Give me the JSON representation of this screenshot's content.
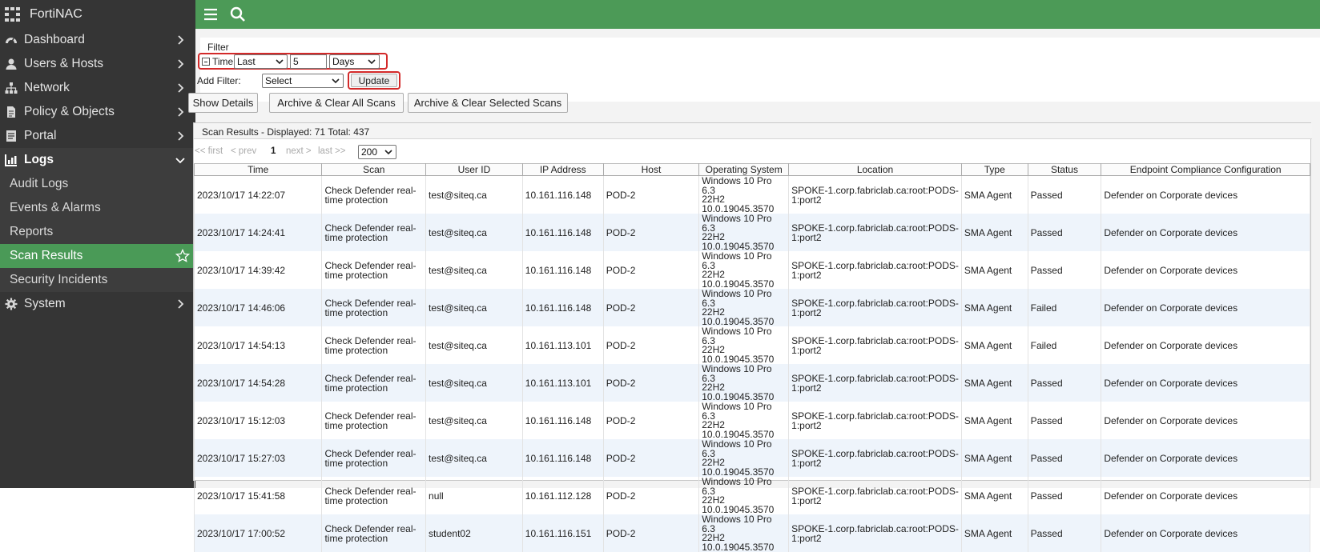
{
  "app": {
    "title": "FortiNAC"
  },
  "sidebar": {
    "items": [
      {
        "label": "Dashboard",
        "icon": "dashboard-icon"
      },
      {
        "label": "Users & Hosts",
        "icon": "user-icon"
      },
      {
        "label": "Network",
        "icon": "network-icon"
      },
      {
        "label": "Policy & Objects",
        "icon": "policy-icon"
      },
      {
        "label": "Portal",
        "icon": "portal-icon"
      },
      {
        "label": "Logs",
        "icon": "logs-icon"
      },
      {
        "label": "System",
        "icon": "gear-icon"
      }
    ],
    "logs_sub": [
      "Audit Logs",
      "Events & Alarms",
      "Reports",
      "Scan Results",
      "Security Incidents"
    ]
  },
  "filter": {
    "title": "Filter",
    "time_label": "Time:",
    "time_mode": "Last",
    "time_value": "5",
    "time_unit": "Days",
    "add_filter_label": "Add Filter:",
    "add_filter_value": "Select",
    "update_label": "Update"
  },
  "actions": {
    "show_details": "Show Details",
    "archive_all": "Archive & Clear All Scans",
    "archive_selected": "Archive & Clear Selected Scans"
  },
  "results": {
    "title": "Scan Results - Displayed: 71 Total: 437",
    "pagination": {
      "first": "<< first",
      "prev": "< prev",
      "current": "1",
      "next": "next >",
      "last": "last >>",
      "page_size": "200"
    },
    "columns": [
      "Time",
      "Scan",
      "User ID",
      "IP Address",
      "Host",
      "Operating System",
      "Location",
      "Type",
      "Status",
      "Endpoint Compliance Configuration"
    ],
    "rows": [
      {
        "time": "2023/10/17 14:22:07",
        "scan": "Check Defender real-time protection",
        "user": "test@siteq.ca",
        "ip": "10.161.116.148",
        "host": "POD-2",
        "os1": "Windows 10 Pro 6.3",
        "os2": "22H2",
        "os3": "10.0.19045.3570",
        "loc": "SPOKE-1.corp.fabriclab.ca:root:PODS-1:port2",
        "type": "SMA Agent",
        "status": "Passed",
        "config": "Defender on Corporate devices"
      },
      {
        "time": "2023/10/17 14:24:41",
        "scan": "Check Defender real-time protection",
        "user": "test@siteq.ca",
        "ip": "10.161.116.148",
        "host": "POD-2",
        "os1": "Windows 10 Pro 6.3",
        "os2": "22H2",
        "os3": "10.0.19045.3570",
        "loc": "SPOKE-1.corp.fabriclab.ca:root:PODS-1:port2",
        "type": "SMA Agent",
        "status": "Passed",
        "config": "Defender on Corporate devices"
      },
      {
        "time": "2023/10/17 14:39:42",
        "scan": "Check Defender real-time protection",
        "user": "test@siteq.ca",
        "ip": "10.161.116.148",
        "host": "POD-2",
        "os1": "Windows 10 Pro 6.3",
        "os2": "22H2",
        "os3": "10.0.19045.3570",
        "loc": "SPOKE-1.corp.fabriclab.ca:root:PODS-1:port2",
        "type": "SMA Agent",
        "status": "Passed",
        "config": "Defender on Corporate devices"
      },
      {
        "time": "2023/10/17 14:46:06",
        "scan": "Check Defender real-time protection",
        "user": "test@siteq.ca",
        "ip": "10.161.116.148",
        "host": "POD-2",
        "os1": "Windows 10 Pro 6.3",
        "os2": "22H2",
        "os3": "10.0.19045.3570",
        "loc": "SPOKE-1.corp.fabriclab.ca:root:PODS-1:port2",
        "type": "SMA Agent",
        "status": "Failed",
        "config": "Defender on Corporate devices"
      },
      {
        "time": "2023/10/17 14:54:13",
        "scan": "Check Defender real-time protection",
        "user": "test@siteq.ca",
        "ip": "10.161.113.101",
        "host": "POD-2",
        "os1": "Windows 10 Pro 6.3",
        "os2": "22H2",
        "os3": "10.0.19045.3570",
        "loc": "SPOKE-1.corp.fabriclab.ca:root:PODS-1:port2",
        "type": "SMA Agent",
        "status": "Failed",
        "config": "Defender on Corporate devices"
      },
      {
        "time": "2023/10/17 14:54:28",
        "scan": "Check Defender real-time protection",
        "user": "test@siteq.ca",
        "ip": "10.161.113.101",
        "host": "POD-2",
        "os1": "Windows 10 Pro 6.3",
        "os2": "22H2",
        "os3": "10.0.19045.3570",
        "loc": "SPOKE-1.corp.fabriclab.ca:root:PODS-1:port2",
        "type": "SMA Agent",
        "status": "Passed",
        "config": "Defender on Corporate devices"
      },
      {
        "time": "2023/10/17 15:12:03",
        "scan": "Check Defender real-time protection",
        "user": "test@siteq.ca",
        "ip": "10.161.116.148",
        "host": "POD-2",
        "os1": "Windows 10 Pro 6.3",
        "os2": "22H2",
        "os3": "10.0.19045.3570",
        "loc": "SPOKE-1.corp.fabriclab.ca:root:PODS-1:port2",
        "type": "SMA Agent",
        "status": "Passed",
        "config": "Defender on Corporate devices"
      },
      {
        "time": "2023/10/17 15:27:03",
        "scan": "Check Defender real-time protection",
        "user": "test@siteq.ca",
        "ip": "10.161.116.148",
        "host": "POD-2",
        "os1": "Windows 10 Pro 6.3",
        "os2": "22H2",
        "os3": "10.0.19045.3570",
        "loc": "SPOKE-1.corp.fabriclab.ca:root:PODS-1:port2",
        "type": "SMA Agent",
        "status": "Passed",
        "config": "Defender on Corporate devices"
      },
      {
        "time": "2023/10/17 15:41:58",
        "scan": "Check Defender real-time protection",
        "user": "null",
        "ip": "10.161.112.128",
        "host": "POD-2",
        "os1": "Windows 10 Pro 6.3",
        "os2": "22H2",
        "os3": "10.0.19045.3570",
        "loc": "SPOKE-1.corp.fabriclab.ca:root:PODS-1:port2",
        "type": "SMA Agent",
        "status": "Passed",
        "config": "Defender on Corporate devices"
      },
      {
        "time": "2023/10/17 17:00:52",
        "scan": "Check Defender real-time protection",
        "user": "student02",
        "ip": "10.161.116.151",
        "host": "POD-2",
        "os1": "Windows 10 Pro 6.3",
        "os2": "22H2",
        "os3": "10.0.19045.3570",
        "loc": "SPOKE-1.corp.fabriclab.ca:root:PODS-1:port2",
        "type": "SMA Agent",
        "status": "Passed",
        "config": "Defender on Corporate devices"
      }
    ]
  },
  "colors": {
    "sidebar_bg": "#353535",
    "accent_green": "#4c9a57",
    "highlight_red": "#d32a2a",
    "row_alt": "#eef4fb"
  }
}
